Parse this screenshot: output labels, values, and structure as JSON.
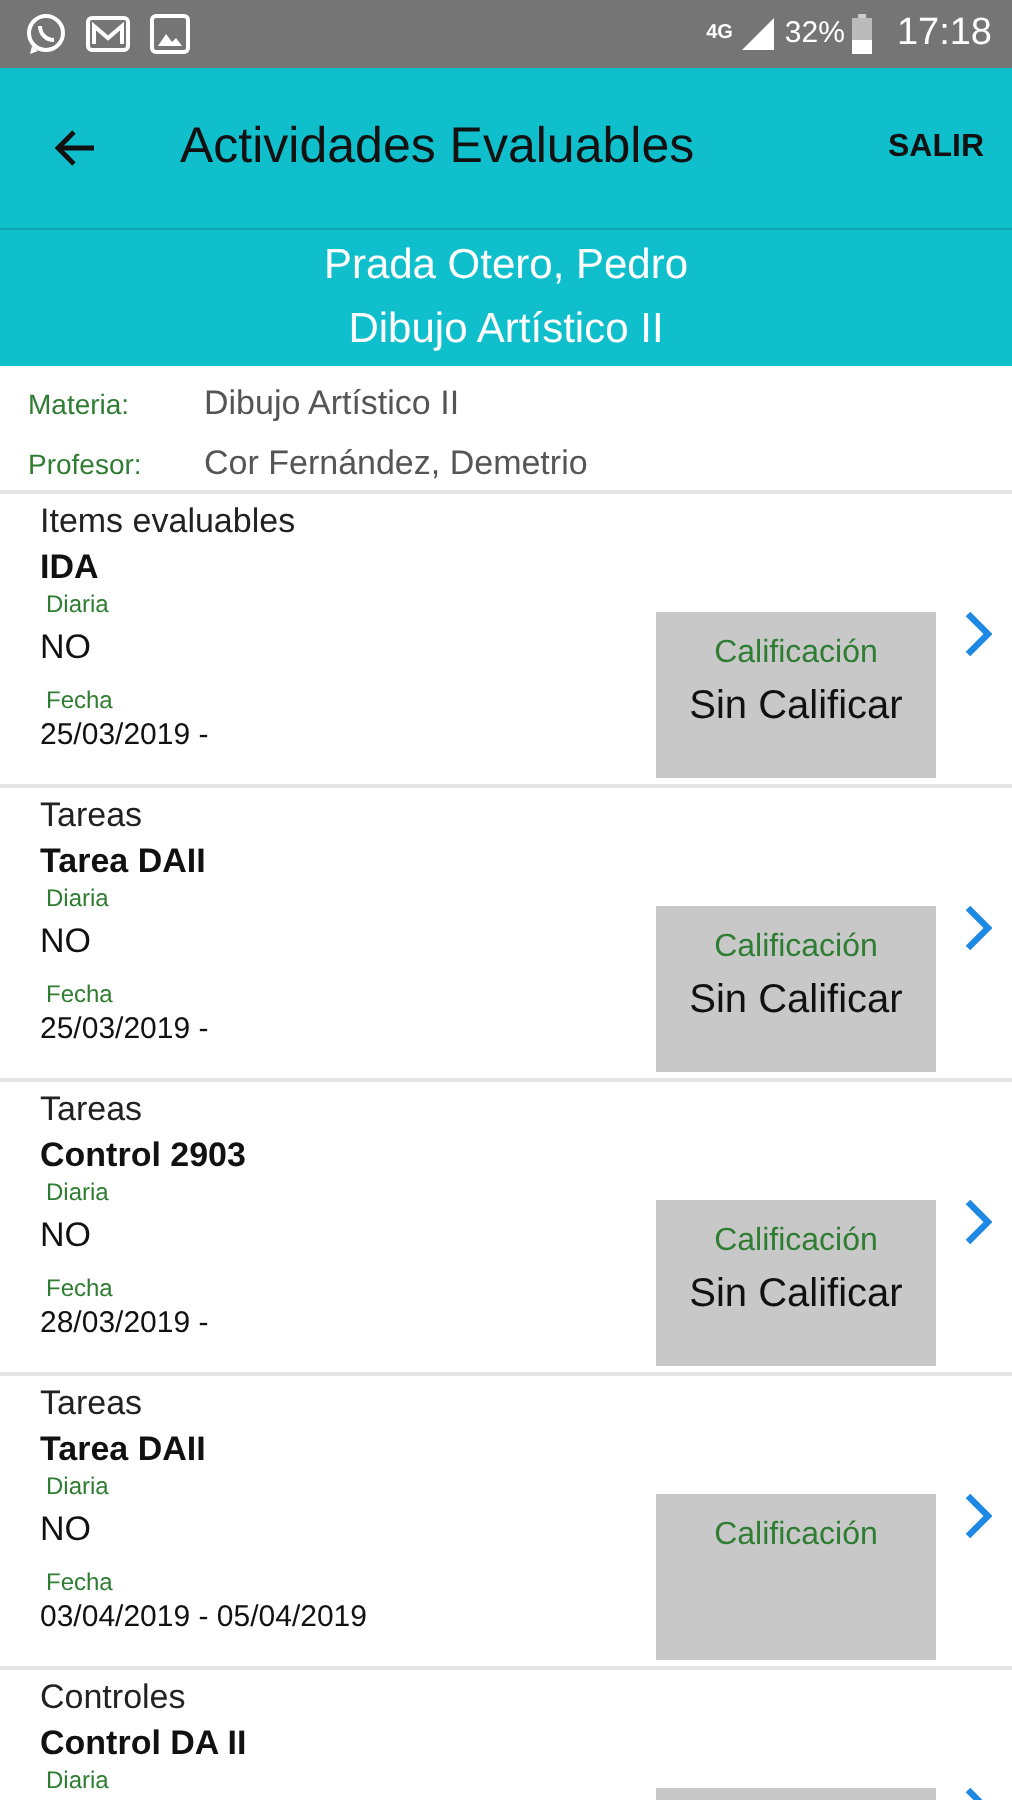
{
  "status_bar": {
    "network": "4G",
    "battery": "32%",
    "time": "17:18"
  },
  "toolbar": {
    "title": "Actividades Evaluables",
    "action": "SALIR"
  },
  "header": {
    "student": "Prada Otero, Pedro",
    "subject": "Dibujo Artístico II"
  },
  "info": [
    {
      "label": "Materia:",
      "value": "Dibujo Artístico II"
    },
    {
      "label": "Profesor:",
      "value": "Cor Fernández, Demetrio"
    }
  ],
  "items": [
    {
      "category": "Items evaluables",
      "title": "IDA",
      "daily_label": "Diaria",
      "daily": "NO",
      "date_label": "Fecha",
      "date": "25/03/2019  -",
      "grade_label": "Calificación",
      "grade": "Sin Calificar"
    },
    {
      "category": "Tareas",
      "title": "Tarea DAII",
      "daily_label": "Diaria",
      "daily": "NO",
      "date_label": "Fecha",
      "date": "25/03/2019  -",
      "grade_label": "Calificación",
      "grade": "Sin Calificar"
    },
    {
      "category": "Tareas",
      "title": "Control 2903",
      "daily_label": "Diaria",
      "daily": "NO",
      "date_label": "Fecha",
      "date": "28/03/2019  -",
      "grade_label": "Calificación",
      "grade": "Sin Calificar"
    },
    {
      "category": "Tareas",
      "title": "Tarea DAII",
      "daily_label": "Diaria",
      "daily": "NO",
      "date_label": "Fecha",
      "date": "03/04/2019  - 05/04/2019",
      "grade_label": "Calificación"
    },
    {
      "category": "Controles",
      "title": "Control DA II",
      "daily_label": "Diaria"
    }
  ]
}
